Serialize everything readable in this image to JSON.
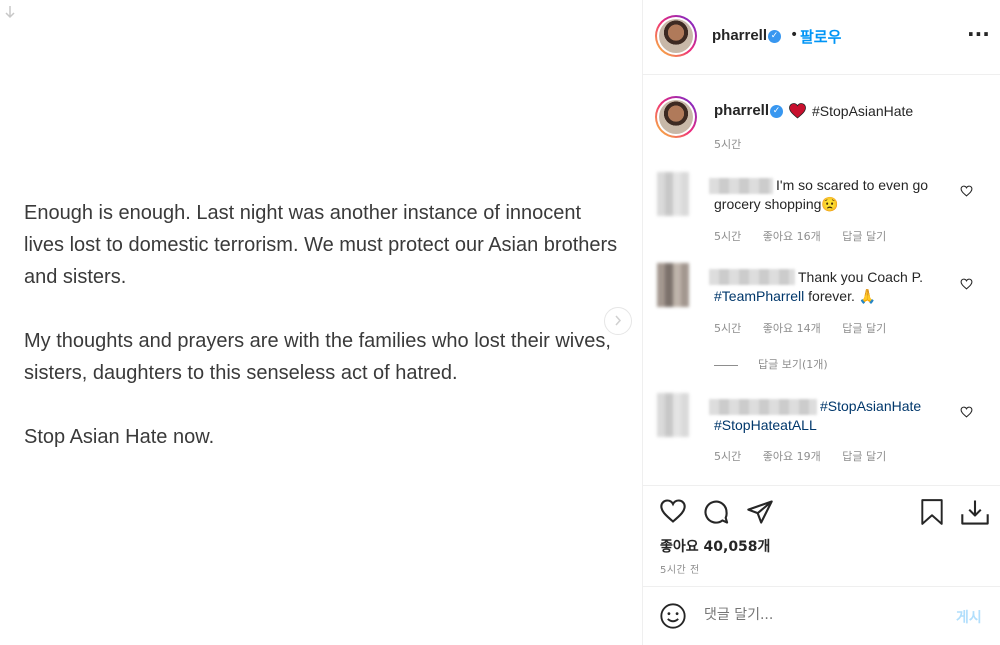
{
  "post": {
    "paragraph_1": "Enough is enough. Last night was another instance of innocent lives lost to domestic terrorism. We must protect our Asian brothers and sisters.",
    "paragraph_2": "My thoughts and prayers are with the families who lost their wives, sisters, daughters to this senseless act of hatred.",
    "paragraph_3": "Stop Asian Hate now."
  },
  "header": {
    "username": "pharrell",
    "follow_label": "팔로우",
    "separator": "•"
  },
  "caption": {
    "username": "pharrell",
    "hashtag": "#StopAsianHate",
    "time": "5시간"
  },
  "comments": [
    {
      "text": "I'm so scared to even go grocery shopping",
      "emoji": "😟",
      "time": "5시간",
      "likes": "좋아요 16개",
      "reply": "답글 달기"
    },
    {
      "text": "Thank you Coach P.",
      "hashtag": "#TeamPharrell",
      "text_after": "forever.",
      "emoji": "🙏",
      "time": "5시간",
      "likes": "좋아요 14개",
      "reply": "답글 달기",
      "view_replies": "답글 보기(1개)"
    },
    {
      "hashtag_1": "#StopAsianHate",
      "hashtag_2": "#StopHateatALL",
      "time": "5시간",
      "likes": "좋아요 19개",
      "reply": "답글 달기"
    }
  ],
  "footer": {
    "likes_label": "좋아요 40,058개",
    "time_ago": "5시간 전",
    "comment_placeholder": "댓글 달기...",
    "post_label": "게시"
  },
  "colors": {
    "link": "#0095f6",
    "hashtag": "#00376b",
    "verified": "#3897f0",
    "muted": "#8e8e8e"
  },
  "icons": [
    "download-icon",
    "next-arrow-icon",
    "verified-icon",
    "more-icon",
    "heart-icon",
    "comment-icon",
    "share-icon",
    "bookmark-icon",
    "save-icon",
    "emoji-icon"
  ]
}
